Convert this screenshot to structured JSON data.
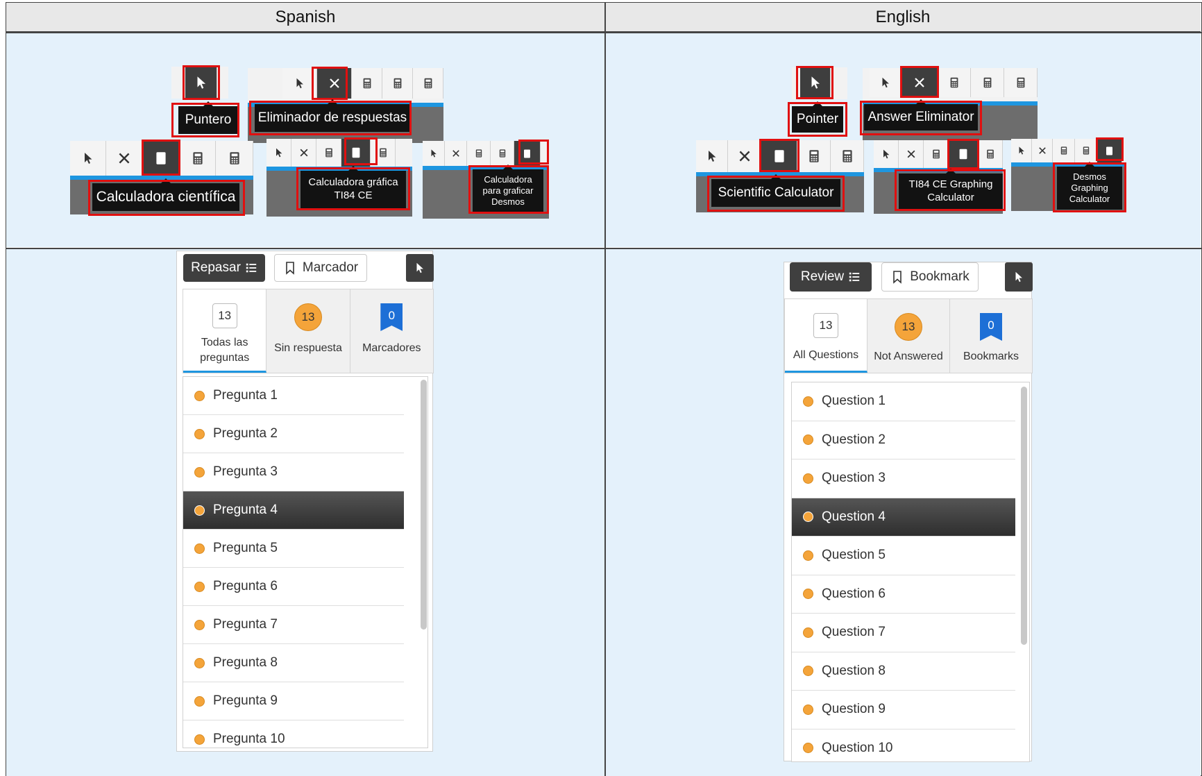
{
  "headers": {
    "left": "Spanish",
    "right": "English"
  },
  "spanish": {
    "tooltips": {
      "pointer": "Puntero",
      "eliminator": "Eliminador de respuestas",
      "scientific": "Calculadora científica",
      "ti84_line1": "Calculadora gráfica",
      "ti84_line2": "TI84 CE",
      "desmos_line1": "Calculadora",
      "desmos_line2": "para graficar",
      "desmos_line3": "Desmos"
    },
    "review": {
      "review_label": "Repasar",
      "bookmark_label": "Marcador",
      "tabs": [
        {
          "count": "13",
          "label_line1": "Todas las",
          "label_line2": "preguntas"
        },
        {
          "count": "13",
          "label_line1": "Sin respuesta",
          "label_line2": ""
        },
        {
          "count": "0",
          "label_line1": "Marcadores",
          "label_line2": ""
        }
      ],
      "questions": [
        "Pregunta 1",
        "Pregunta 2",
        "Pregunta 3",
        "Pregunta 4",
        "Pregunta 5",
        "Pregunta 6",
        "Pregunta 7",
        "Pregunta 8",
        "Pregunta 9",
        "Pregunta 10"
      ],
      "selected_index": 3
    }
  },
  "english": {
    "tooltips": {
      "pointer": "Pointer",
      "eliminator": "Answer Eliminator",
      "scientific": "Scientific Calculator",
      "ti84_line1": "TI84 CE Graphing",
      "ti84_line2": "Calculator",
      "desmos_line1": "Desmos",
      "desmos_line2": "Graphing",
      "desmos_line3": "Calculator"
    },
    "review": {
      "review_label": "Review",
      "bookmark_label": "Bookmark",
      "tabs": [
        {
          "count": "13",
          "label_line1": "All Questions",
          "label_line2": ""
        },
        {
          "count": "13",
          "label_line1": "Not Answered",
          "label_line2": ""
        },
        {
          "count": "0",
          "label_line1": "Bookmarks",
          "label_line2": ""
        }
      ],
      "questions": [
        "Question 1",
        "Question 2",
        "Question 3",
        "Question 4",
        "Question 5",
        "Question 6",
        "Question 7",
        "Question 8",
        "Question 9",
        "Question 10"
      ],
      "selected_index": 3
    }
  },
  "colors": {
    "highlight": "#e01010",
    "cell_bg": "#e4f1fb",
    "accent_blue": "#1e96e0",
    "dot_orange": "#f4a43a",
    "bookmark_blue": "#1d6fd6"
  }
}
